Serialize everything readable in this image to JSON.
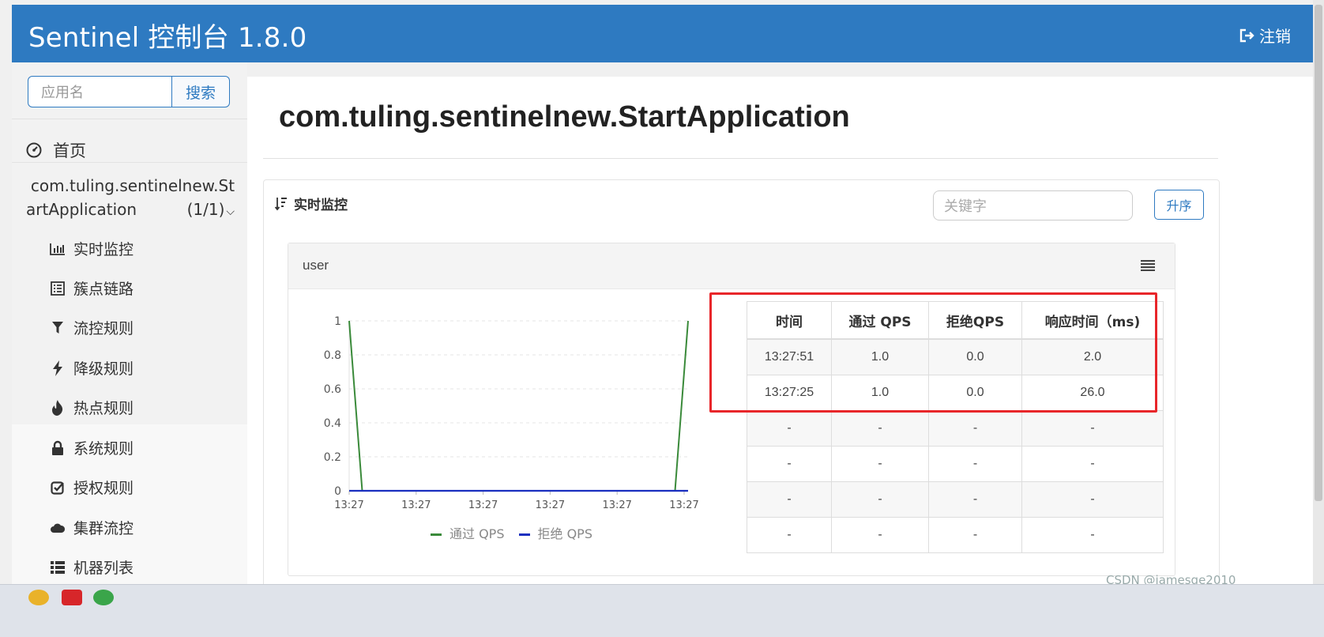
{
  "header": {
    "brand": "Sentinel 控制台 1.8.0",
    "logout_label": "注销",
    "colors": {
      "primary": "#2e7ac1"
    }
  },
  "sidebar": {
    "search_placeholder": "应用名",
    "search_button": "搜索",
    "home_label": "首页",
    "app": {
      "line1": "com.tuling.sentinelnew.St",
      "line2": "artApplication",
      "count": "(1/1)"
    },
    "menu": [
      {
        "label": "实时监控",
        "icon": "bar-chart-icon"
      },
      {
        "label": "簇点链路",
        "icon": "list-alt-icon"
      },
      {
        "label": "流控规则",
        "icon": "filter-icon"
      },
      {
        "label": "降级规则",
        "icon": "flash-icon"
      },
      {
        "label": "热点规则",
        "icon": "fire-icon"
      },
      {
        "label": "系统规则",
        "icon": "lock-icon"
      },
      {
        "label": "授权规则",
        "icon": "check-square-icon"
      },
      {
        "label": "集群流控",
        "icon": "cloud-icon"
      },
      {
        "label": "机器列表",
        "icon": "th-list-icon"
      }
    ]
  },
  "main": {
    "title": "com.tuling.sentinelnew.StartApplication",
    "panel_title": "实时监控",
    "keyword_placeholder": "关键字",
    "sort_button": "升序",
    "resource_name": "user",
    "table": {
      "headers": [
        "时间",
        "通过 QPS",
        "拒绝QPS",
        "响应时间（ms)"
      ],
      "rows": [
        [
          "13:27:51",
          "1.0",
          "0.0",
          "2.0"
        ],
        [
          "13:27:25",
          "1.0",
          "0.0",
          "26.0"
        ],
        [
          "-",
          "-",
          "-",
          "-"
        ],
        [
          "-",
          "-",
          "-",
          "-"
        ],
        [
          "-",
          "-",
          "-",
          "-"
        ],
        [
          "-",
          "-",
          "-",
          "-"
        ]
      ]
    }
  },
  "chart_data": {
    "type": "line",
    "title": "",
    "xlabel": "",
    "ylabel": "",
    "ylim": [
      0,
      1
    ],
    "yticks": [
      "0",
      "0.2",
      "0.4",
      "0.6",
      "0.8",
      "1"
    ],
    "xticks": [
      "13:27",
      "13:27",
      "13:27",
      "13:27",
      "13:27",
      "13:27"
    ],
    "grid": true,
    "legend_position": "bottom",
    "series": [
      {
        "name": "通过 QPS",
        "color": "#3a8a3a",
        "values": [
          1,
          0,
          0,
          0,
          0,
          0,
          0,
          0,
          0,
          0,
          0,
          0,
          0,
          0,
          0,
          0,
          0,
          0,
          0,
          0,
          0,
          0,
          0,
          0,
          0,
          0,
          1
        ]
      },
      {
        "name": "拒绝 QPS",
        "color": "#1a2fbf",
        "values": [
          0,
          0,
          0,
          0,
          0,
          0,
          0,
          0,
          0,
          0,
          0,
          0,
          0,
          0,
          0,
          0,
          0,
          0,
          0,
          0,
          0,
          0,
          0,
          0,
          0,
          0,
          0
        ]
      }
    ]
  },
  "watermark": "CSDN @jamesge2010"
}
